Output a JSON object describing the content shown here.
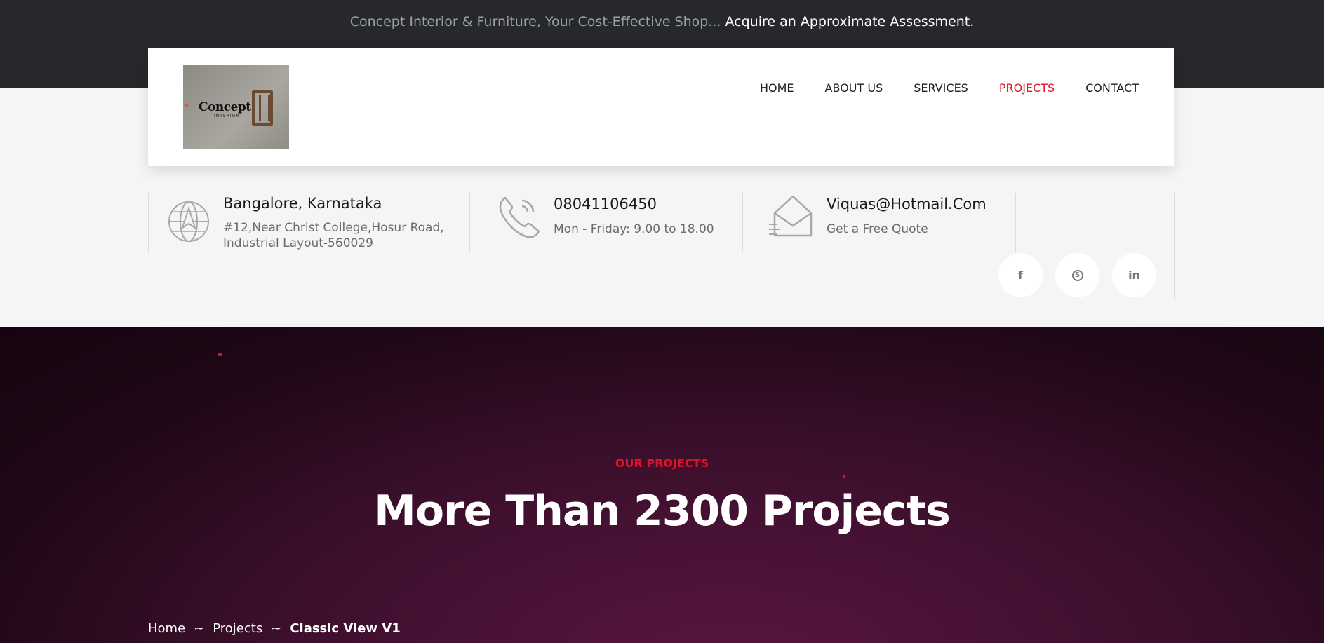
{
  "topbar": {
    "text": "Concept Interior & Furniture, Your Cost-Effective Shop...",
    "highlight": "Acquire an Approximate Assessment."
  },
  "header": {
    "logo_text": "Concept",
    "logo_sub": "INTERIOR",
    "nav": [
      {
        "label": "HOME",
        "active": false
      },
      {
        "label": "ABOUT US",
        "active": false
      },
      {
        "label": "SERVICES",
        "active": false
      },
      {
        "label": "PROJECTS",
        "active": true
      },
      {
        "label": "CONTACT",
        "active": false
      }
    ]
  },
  "info": {
    "address_title": "Bangalore, Karnataka",
    "address_line1": "#12,Near Christ College,Hosur Road,",
    "address_line2": "Industrial Layout-560029",
    "phone_title": "08041106450",
    "phone_sub": "Mon - Friday: 9.00 to 18.00",
    "email_title": "Viquas@Hotmail.Com",
    "email_sub": "Get a Free Quote"
  },
  "social": {
    "facebook": "f",
    "skype": "S",
    "linkedin": "in"
  },
  "hero": {
    "subtitle": "OUR PROJECTS",
    "title": "More Than 2300 Projects"
  },
  "breadcrumb": {
    "home": "Home",
    "sep": "~",
    "projects": "Projects",
    "current": "Classic View V1"
  },
  "colors": {
    "accent": "#e0132b",
    "dark": "#26282c",
    "hero": "#3c0f2c"
  }
}
